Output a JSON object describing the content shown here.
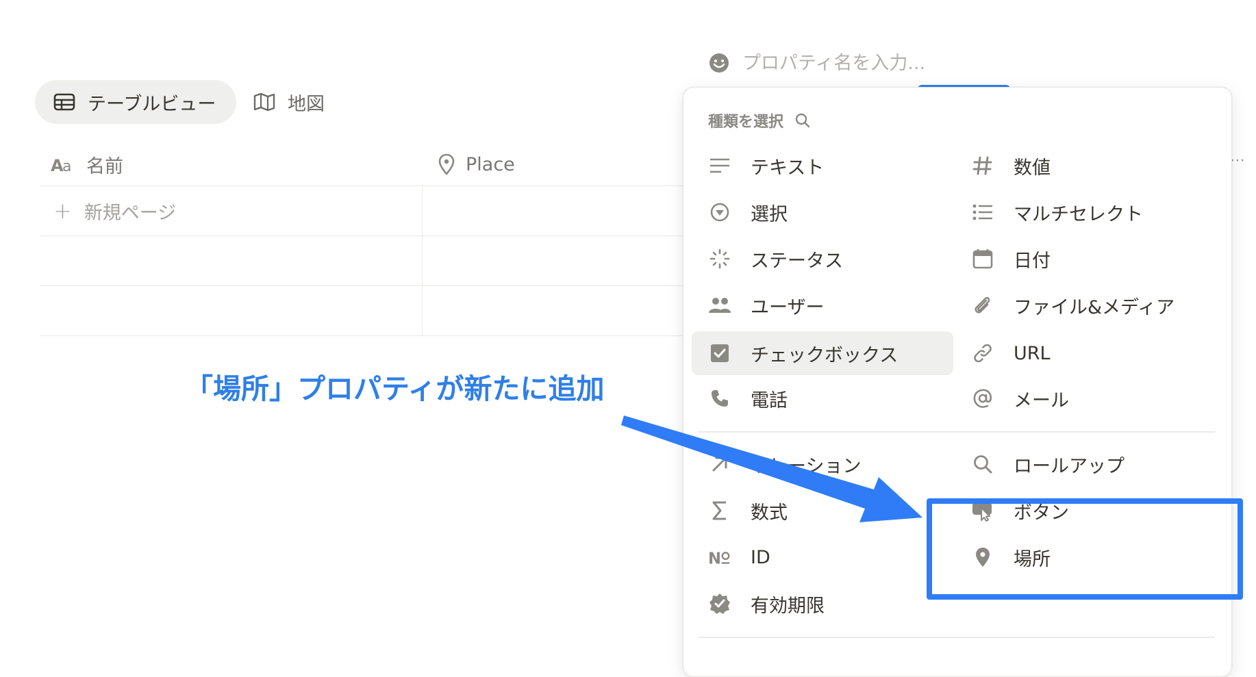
{
  "property_name": {
    "placeholder": "プロパティ名を入力..."
  },
  "views": {
    "active_label": "テーブルビュー",
    "map_label": "地図"
  },
  "table": {
    "columns": [
      "名前",
      "Place"
    ],
    "new_page_label": "新規ページ"
  },
  "menu": {
    "header": "種類を選択",
    "left_items": [
      {
        "label": "テキスト",
        "icon": "text-lines-icon"
      },
      {
        "label": "選択",
        "icon": "select-circle-icon"
      },
      {
        "label": "ステータス",
        "icon": "status-spinner-icon"
      },
      {
        "label": "ユーザー",
        "icon": "people-icon"
      },
      {
        "label": "チェックボックス",
        "icon": "checkbox-icon"
      },
      {
        "label": "電話",
        "icon": "phone-icon"
      },
      {
        "label": "リレーション",
        "icon": "arrow-up-right-icon"
      },
      {
        "label": "数式",
        "icon": "sigma-icon"
      },
      {
        "label": "ID",
        "icon": "numero-icon"
      },
      {
        "label": "有効期限",
        "icon": "verified-badge-icon"
      }
    ],
    "right_items": [
      {
        "label": "数値",
        "icon": "hash-icon"
      },
      {
        "label": "マルチセレクト",
        "icon": "list-icon"
      },
      {
        "label": "日付",
        "icon": "calendar-icon"
      },
      {
        "label": "ファイル&メディア",
        "icon": "paperclip-icon"
      },
      {
        "label": "URL",
        "icon": "link-icon"
      },
      {
        "label": "メール",
        "icon": "at-icon"
      },
      {
        "label": "ロールアップ",
        "icon": "magnifier-icon"
      },
      {
        "label": "ボタン",
        "icon": "button-cursor-icon"
      },
      {
        "label": "場所",
        "icon": "location-pin-icon"
      }
    ]
  },
  "annotation": {
    "text": "「場所」プロパティが新たに追加",
    "color": "#2f7fe8"
  }
}
